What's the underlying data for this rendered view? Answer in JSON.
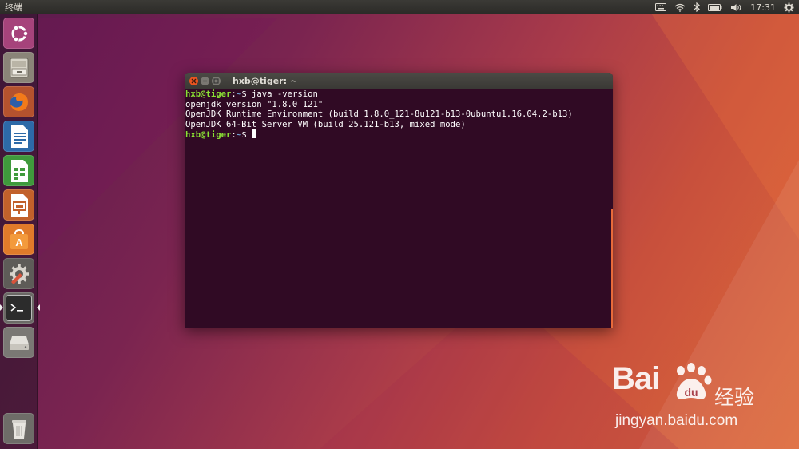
{
  "top_panel": {
    "app_title": "终端",
    "indicators": [
      "keyboard-icon",
      "wifi-icon",
      "bluetooth-icon",
      "battery-icon",
      "volume-icon"
    ],
    "clock": "17:31",
    "session_icon": "gear-icon"
  },
  "launcher": {
    "items": [
      {
        "name": "ubuntu-dash",
        "icon": "ubuntu-logo-icon"
      },
      {
        "name": "files",
        "icon": "file-cabinet-icon"
      },
      {
        "name": "firefox",
        "icon": "firefox-icon"
      },
      {
        "name": "libreoffice-writer",
        "icon": "writer-icon"
      },
      {
        "name": "libreoffice-calc",
        "icon": "calc-icon"
      },
      {
        "name": "libreoffice-impress",
        "icon": "impress-icon"
      },
      {
        "name": "ubuntu-software",
        "icon": "software-center-icon"
      },
      {
        "name": "system-settings",
        "icon": "settings-icon"
      },
      {
        "name": "terminal",
        "icon": "terminal-icon",
        "active": true
      },
      {
        "name": "drive",
        "icon": "drive-icon"
      },
      {
        "name": "trash",
        "icon": "trash-icon"
      }
    ]
  },
  "terminal": {
    "title": "hxb@tiger: ~",
    "lines": [
      {
        "user": "hxb@tiger",
        "path": "~",
        "cmd": " java -version"
      },
      {
        "text": "openjdk version \"1.8.0_121\""
      },
      {
        "text": "OpenJDK Runtime Environment (build 1.8.0_121-8u121-b13-0ubuntu1.16.04.2-b13)"
      },
      {
        "text": "OpenJDK 64-Bit Server VM (build 25.121-b13, mixed mode)"
      },
      {
        "user": "hxb@tiger",
        "path": "~",
        "cmd": " "
      }
    ]
  },
  "watermark": {
    "brand": "Bai",
    "cn": "经验",
    "url": "jingyan.baidu.com"
  },
  "colors": {
    "terminal_bg": "#300a24",
    "prompt_user": "#8ae234",
    "prompt_path": "#729fcf",
    "accent": "#e95420"
  }
}
